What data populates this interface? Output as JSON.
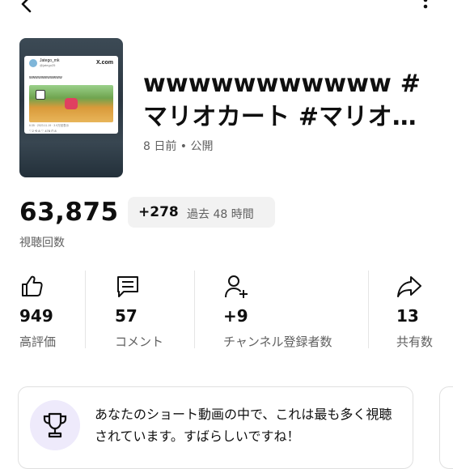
{
  "video": {
    "title": "wwwwwwwwwww #マリオカート #マリオカート",
    "meta": "8 日前 • 公開"
  },
  "thumbnail": {
    "handle": "Jatego_mk",
    "subhandle": "@jatego25",
    "brand": "X.com",
    "text": "wwwwwwwwwww",
    "meta": "6:35 · 2023.11.19 · 3.9万回表示",
    "actions": "♡2   ⟲ 8   ♡ 478   ⊓ 8"
  },
  "views": {
    "count": "63,875",
    "label": "視聴回数",
    "delta": "+278",
    "period": "過去 48 時間"
  },
  "stats": [
    {
      "icon": "thumbs-up-icon",
      "value": "949",
      "label": "高評価"
    },
    {
      "icon": "comment-icon",
      "value": "57",
      "label": "コメント"
    },
    {
      "icon": "add-person-icon",
      "value": "+9",
      "label": "チャンネル登録者数"
    },
    {
      "icon": "share-icon",
      "value": "13",
      "label": "共有数"
    }
  ],
  "insight": {
    "icon": "trophy-icon",
    "text": "あなたのショート動画の中で、これは最も多く視聴されています。すばらしいですね！"
  }
}
